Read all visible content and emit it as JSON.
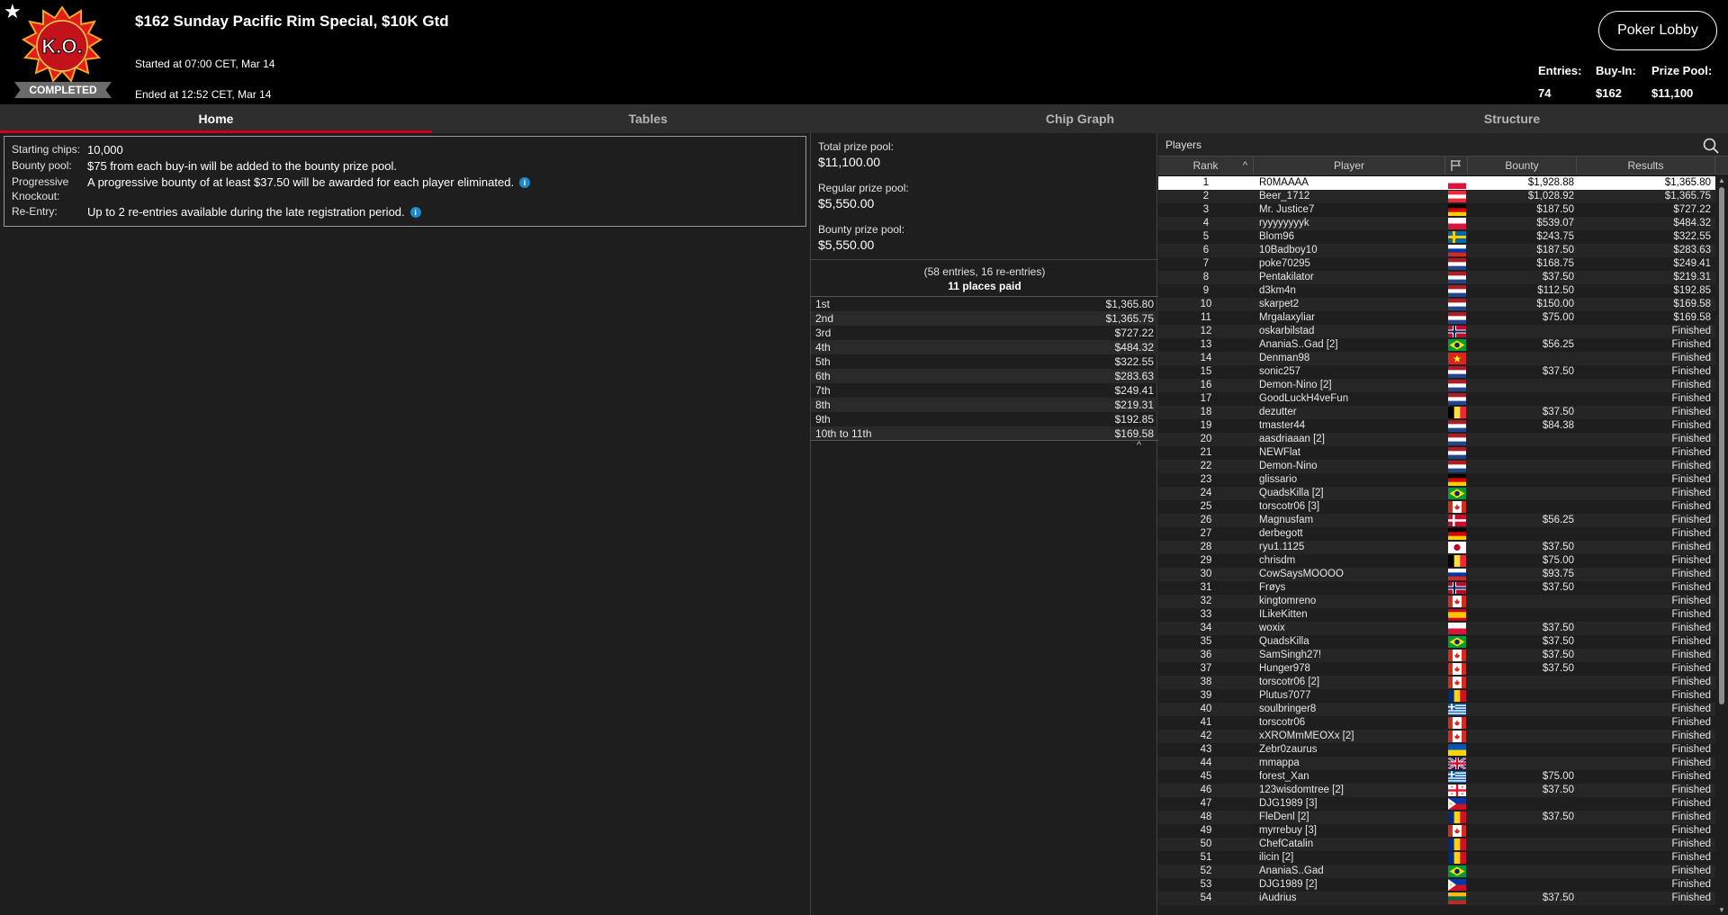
{
  "header": {
    "title": "$162 Sunday Pacific Rim Special, $10K Gtd",
    "logo_text": "K.O.",
    "status_badge": "COMPLETED",
    "started": "Started at 07:00 CET, Mar 14",
    "ended": "Ended at 12:52 CET, Mar 14",
    "lobby_button": "Poker Lobby",
    "stats": {
      "entries_label": "Entries:",
      "entries_value": "74",
      "buyin_label": "Buy-In:",
      "buyin_value": "$162",
      "prizepool_label": "Prize Pool:",
      "prizepool_value": "$11,100"
    }
  },
  "tabs": [
    {
      "label": "Home",
      "active": true
    },
    {
      "label": "Tables",
      "active": false
    },
    {
      "label": "Chip Graph",
      "active": false
    },
    {
      "label": "Structure",
      "active": false
    }
  ],
  "home": {
    "rows": [
      {
        "label": "Starting chips:",
        "value": "10,000",
        "info": false
      },
      {
        "label": "Bounty pool:",
        "value": "$75 from each buy-in will be added to the bounty prize pool.",
        "info": false
      },
      {
        "label": "Progressive Knockout:",
        "value": "A progressive bounty of at least $37.50 will be awarded for each player eliminated.",
        "info": true
      },
      {
        "label": "Re-Entry:",
        "value": "Up to 2 re-entries available during the late registration period.",
        "info": true
      }
    ]
  },
  "prizes": {
    "total_label": "Total prize pool:",
    "total_value": "$11,100.00",
    "regular_label": "Regular prize pool:",
    "regular_value": "$5,550.00",
    "bounty_label": "Bounty prize pool:",
    "bounty_value": "$5,550.00",
    "entries_note": "(58 entries, 16 re-entries)",
    "places_paid": "11 places paid",
    "payouts": [
      {
        "place": "1st",
        "amount": "$1,365.80"
      },
      {
        "place": "2nd",
        "amount": "$1,365.75"
      },
      {
        "place": "3rd",
        "amount": "$727.22"
      },
      {
        "place": "4th",
        "amount": "$484.32"
      },
      {
        "place": "5th",
        "amount": "$322.55"
      },
      {
        "place": "6th",
        "amount": "$283.63"
      },
      {
        "place": "7th",
        "amount": "$249.41"
      },
      {
        "place": "8th",
        "amount": "$219.31"
      },
      {
        "place": "9th",
        "amount": "$192.85"
      },
      {
        "place": "10th to 11th",
        "amount": "$169.58"
      }
    ]
  },
  "players": {
    "title": "Players",
    "columns": {
      "rank": "Rank",
      "player": "Player",
      "bounty": "Bounty",
      "results": "Results"
    },
    "rows": [
      {
        "rank": "1",
        "name": "R0MAAAA",
        "flag": "pl",
        "bounty": "$1,928.88",
        "result": "$1,365.80"
      },
      {
        "rank": "2",
        "name": "Beer_1712",
        "flag": "at",
        "bounty": "$1,028.92",
        "result": "$1,365.75"
      },
      {
        "rank": "3",
        "name": "Mr. Justice7",
        "flag": "de",
        "bounty": "$187.50",
        "result": "$727.22"
      },
      {
        "rank": "4",
        "name": "ryyyyyyyyk",
        "flag": "pl",
        "bounty": "$539.07",
        "result": "$484.32"
      },
      {
        "rank": "5",
        "name": "Blom96",
        "flag": "se",
        "bounty": "$243.75",
        "result": "$322.55"
      },
      {
        "rank": "6",
        "name": "10Badboy10",
        "flag": "ru",
        "bounty": "$187.50",
        "result": "$283.63"
      },
      {
        "rank": "7",
        "name": "poke70295",
        "flag": "nl",
        "bounty": "$168.75",
        "result": "$249.41"
      },
      {
        "rank": "8",
        "name": "Pentakilator",
        "flag": "nl",
        "bounty": "$37.50",
        "result": "$219.31"
      },
      {
        "rank": "9",
        "name": "d3km4n",
        "flag": "nl",
        "bounty": "$112.50",
        "result": "$192.85"
      },
      {
        "rank": "10",
        "name": "skarpet2",
        "flag": "nl",
        "bounty": "$150.00",
        "result": "$169.58"
      },
      {
        "rank": "11",
        "name": "Mrgalaxyliar",
        "flag": "nl",
        "bounty": "$75.00",
        "result": "$169.58"
      },
      {
        "rank": "12",
        "name": "oskarbilstad",
        "flag": "no",
        "bounty": "",
        "result": "Finished"
      },
      {
        "rank": "13",
        "name": "AnaniaS..Gad [2]",
        "flag": "br",
        "bounty": "$56.25",
        "result": "Finished"
      },
      {
        "rank": "14",
        "name": "Denman98",
        "flag": "vn",
        "bounty": "",
        "result": "Finished"
      },
      {
        "rank": "15",
        "name": "sonic257",
        "flag": "nl",
        "bounty": "$37.50",
        "result": "Finished"
      },
      {
        "rank": "16",
        "name": "Demon-Nino [2]",
        "flag": "nl",
        "bounty": "",
        "result": "Finished"
      },
      {
        "rank": "17",
        "name": "GoodLuckH4veFun",
        "flag": "nl",
        "bounty": "",
        "result": "Finished"
      },
      {
        "rank": "18",
        "name": "dezutter",
        "flag": "be",
        "bounty": "$37.50",
        "result": "Finished"
      },
      {
        "rank": "19",
        "name": "tmaster44",
        "flag": "nl",
        "bounty": "$84.38",
        "result": "Finished"
      },
      {
        "rank": "20",
        "name": "aasdriaaan [2]",
        "flag": "nl",
        "bounty": "",
        "result": "Finished"
      },
      {
        "rank": "21",
        "name": "NEWFlat",
        "flag": "nl",
        "bounty": "",
        "result": "Finished"
      },
      {
        "rank": "22",
        "name": "Demon-Nino",
        "flag": "nl",
        "bounty": "",
        "result": "Finished"
      },
      {
        "rank": "23",
        "name": "glissario",
        "flag": "de",
        "bounty": "",
        "result": "Finished"
      },
      {
        "rank": "24",
        "name": "QuadsKilla [2]",
        "flag": "br",
        "bounty": "",
        "result": "Finished"
      },
      {
        "rank": "25",
        "name": "torscotr06 [3]",
        "flag": "ca",
        "bounty": "",
        "result": "Finished"
      },
      {
        "rank": "26",
        "name": "Magnusfam",
        "flag": "dk",
        "bounty": "$56.25",
        "result": "Finished"
      },
      {
        "rank": "27",
        "name": "derbegott",
        "flag": "de",
        "bounty": "",
        "result": "Finished"
      },
      {
        "rank": "28",
        "name": "ryu1.1125",
        "flag": "jp",
        "bounty": "$37.50",
        "result": "Finished"
      },
      {
        "rank": "29",
        "name": "chrisdm",
        "flag": "be",
        "bounty": "$75.00",
        "result": "Finished"
      },
      {
        "rank": "30",
        "name": "CowSaysMOOOO",
        "flag": "ru",
        "bounty": "$93.75",
        "result": "Finished"
      },
      {
        "rank": "31",
        "name": "Frøys",
        "flag": "no",
        "bounty": "$37.50",
        "result": "Finished"
      },
      {
        "rank": "32",
        "name": "kingtomreno",
        "flag": "ca",
        "bounty": "",
        "result": "Finished"
      },
      {
        "rank": "33",
        "name": "ILikeKitten",
        "flag": "es",
        "bounty": "",
        "result": "Finished"
      },
      {
        "rank": "34",
        "name": "woxix",
        "flag": "pl",
        "bounty": "$37.50",
        "result": "Finished"
      },
      {
        "rank": "35",
        "name": "QuadsKilla",
        "flag": "br",
        "bounty": "$37.50",
        "result": "Finished"
      },
      {
        "rank": "36",
        "name": "SamSingh27!",
        "flag": "ca",
        "bounty": "$37.50",
        "result": "Finished"
      },
      {
        "rank": "37",
        "name": "Hunger978",
        "flag": "ca",
        "bounty": "$37.50",
        "result": "Finished"
      },
      {
        "rank": "38",
        "name": "torscotr06 [2]",
        "flag": "ca",
        "bounty": "",
        "result": "Finished"
      },
      {
        "rank": "39",
        "name": "Plutus7077",
        "flag": "ro",
        "bounty": "",
        "result": "Finished"
      },
      {
        "rank": "40",
        "name": "soulbringer8",
        "flag": "gr",
        "bounty": "",
        "result": "Finished"
      },
      {
        "rank": "41",
        "name": "torscotr06",
        "flag": "ca",
        "bounty": "",
        "result": "Finished"
      },
      {
        "rank": "42",
        "name": "xXROMmMEOXx [2]",
        "flag": "ca",
        "bounty": "",
        "result": "Finished"
      },
      {
        "rank": "43",
        "name": "Zebr0zaurus",
        "flag": "ua",
        "bounty": "",
        "result": "Finished"
      },
      {
        "rank": "44",
        "name": "mmappa",
        "flag": "gb",
        "bounty": "",
        "result": "Finished"
      },
      {
        "rank": "45",
        "name": "forest_Xan",
        "flag": "gr",
        "bounty": "$75.00",
        "result": "Finished"
      },
      {
        "rank": "46",
        "name": "123wisdomtree [2]",
        "flag": "ge",
        "bounty": "$37.50",
        "result": "Finished"
      },
      {
        "rank": "47",
        "name": "DJG1989 [3]",
        "flag": "ph",
        "bounty": "",
        "result": "Finished"
      },
      {
        "rank": "48",
        "name": "FleDenl [2]",
        "flag": "ro",
        "bounty": "$37.50",
        "result": "Finished"
      },
      {
        "rank": "49",
        "name": "myrrebuy [3]",
        "flag": "ca",
        "bounty": "",
        "result": "Finished"
      },
      {
        "rank": "50",
        "name": "ChefCatalin",
        "flag": "ro",
        "bounty": "",
        "result": "Finished"
      },
      {
        "rank": "51",
        "name": "ilicin [2]",
        "flag": "ro",
        "bounty": "",
        "result": "Finished"
      },
      {
        "rank": "52",
        "name": "AnaniaS..Gad",
        "flag": "br",
        "bounty": "",
        "result": "Finished"
      },
      {
        "rank": "53",
        "name": "DJG1989 [2]",
        "flag": "ph",
        "bounty": "",
        "result": "Finished"
      },
      {
        "rank": "54",
        "name": "iAudrius",
        "flag": "lt",
        "bounty": "$37.50",
        "result": "Finished"
      }
    ]
  },
  "colors": {
    "accent": "#d0021b",
    "header_bg": "#000000",
    "body_bg": "#1e1e1e",
    "info_icon": "#1e88c8"
  }
}
